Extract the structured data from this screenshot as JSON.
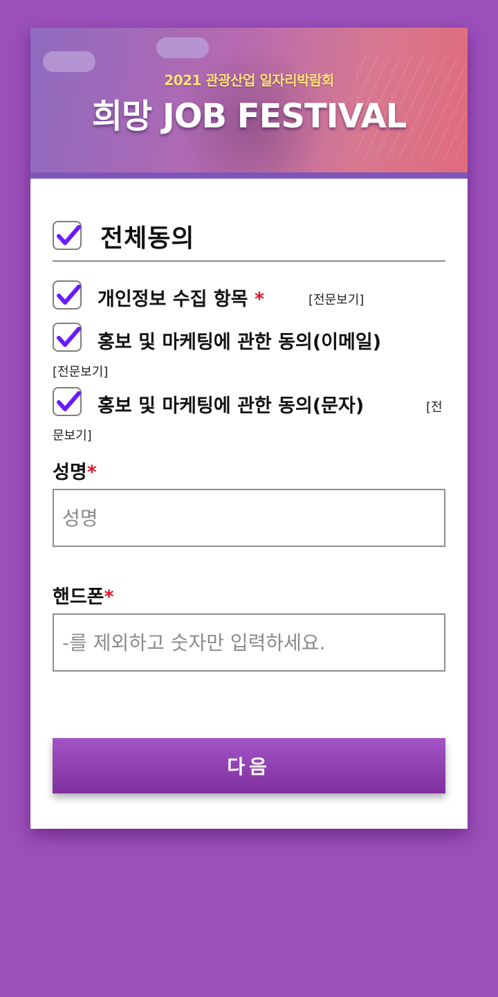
{
  "banner": {
    "subtitle": "2021 관광산업 일자리박람회",
    "title": "희망 JOB FESTIVAL"
  },
  "consent": {
    "all_label": "전체동의",
    "all_checked": true,
    "items": [
      {
        "label": "개인정보 수집 항목",
        "required_mark": "*",
        "link": "[전문보기]",
        "checked": true
      },
      {
        "label": "홍보 및 마케팅에 관한 동의(이메일)",
        "link": "[전문보기]",
        "checked": true
      },
      {
        "label": "홍보 및 마케팅에 관한 동의(문자)",
        "link_part1": "[전",
        "link_part2": "문보기]",
        "checked": true
      }
    ]
  },
  "form": {
    "name": {
      "label": "성명",
      "required_mark": "*",
      "placeholder": "성명",
      "value": ""
    },
    "phone": {
      "label": "핸드폰",
      "required_mark": "*",
      "placeholder": "-를 제외하고 숫자만 입력하세요.",
      "value": ""
    }
  },
  "next_button": "다음",
  "colors": {
    "background": "#9b4fba",
    "check": "#6a1aff",
    "required": "#e0132a",
    "button_top": "#a354c4",
    "button_bottom": "#7f2f9e"
  },
  "icons": {
    "checkbox": "check-icon"
  }
}
